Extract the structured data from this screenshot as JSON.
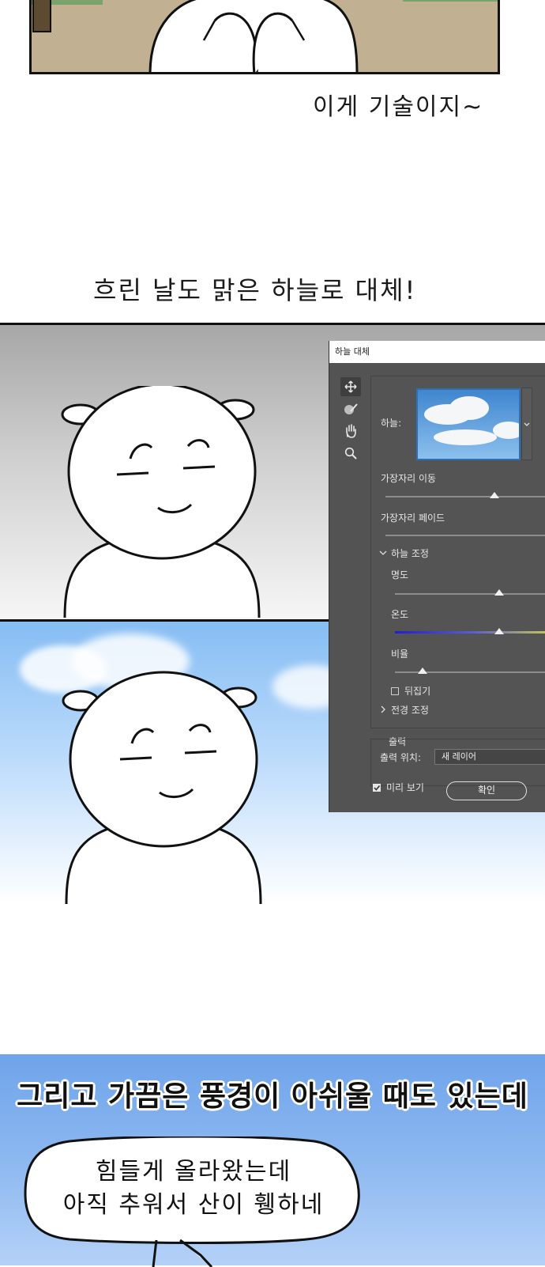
{
  "captions": {
    "skill": "이게 기술이지~",
    "replace": "흐린 날도 맑은 하늘로 대체!",
    "wish": "그리고 가끔은 풍경이 아쉬울 때도 있는데"
  },
  "dialog": {
    "title": "하늘 대체",
    "sky_label": "하늘:",
    "shift_edge": "가장자리 이동",
    "fade_edge": "가장자리 페이드",
    "sky_adjust": "하늘 조정",
    "brightness": "명도",
    "temperature": "온도",
    "scale": "비율",
    "flip": "뒤집기",
    "foreground_adjust": "전경 조정",
    "output_section": "출력",
    "output_to": "출력 위치:",
    "output_value": "새 레이어",
    "preview": "미리 보기",
    "ok": "확인",
    "preview_checked": true,
    "flip_checked": false,
    "colors": {
      "bg": "#535353",
      "temperature_left": "#1f1fd6",
      "temperature_right": "#c9c94a"
    }
  },
  "speech": {
    "line1": "힘들게 올라왔는데",
    "line2": "아직 추워서 산이 휑하네"
  },
  "icons": [
    "move-icon",
    "brush-icon",
    "hand-icon",
    "zoom-icon",
    "chevron-down-icon",
    "chevron-right-icon"
  ]
}
